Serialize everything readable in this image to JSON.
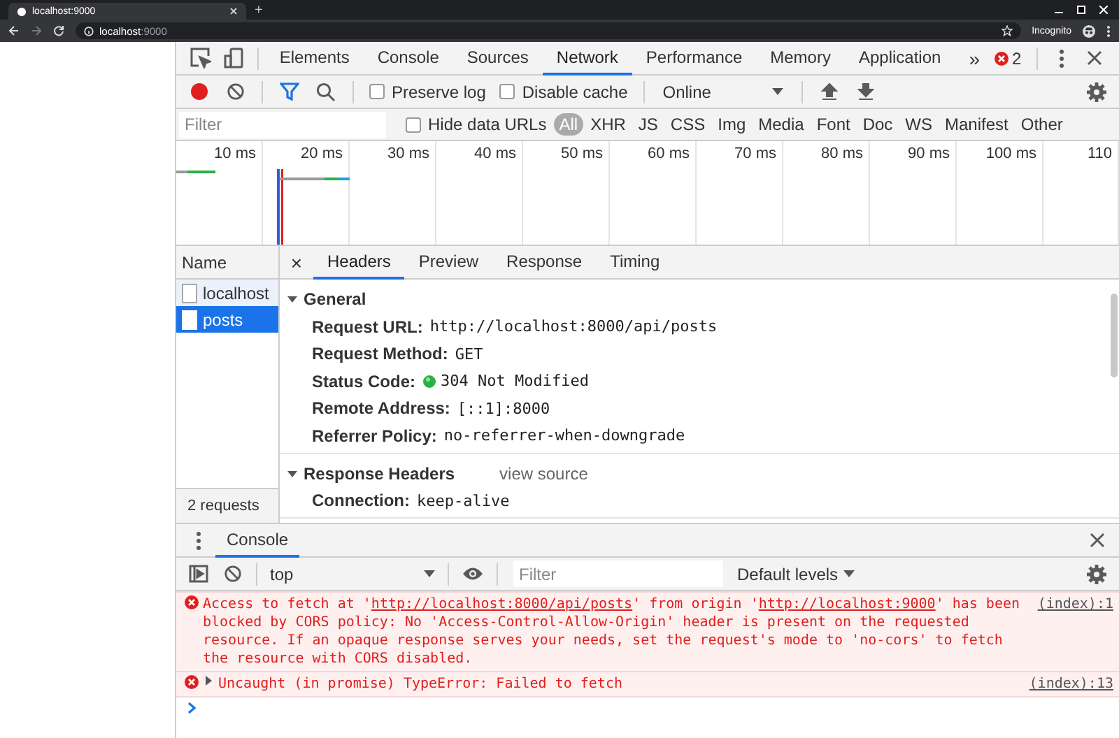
{
  "browser": {
    "tab_title": "localhost:9000",
    "new_tab": "+",
    "address_host": "localhost",
    "address_port": ":9000",
    "profile": "Incognito"
  },
  "devtools_tabs": {
    "tabs": [
      {
        "label": "Elements",
        "selected": false
      },
      {
        "label": "Console",
        "selected": false
      },
      {
        "label": "Sources",
        "selected": false
      },
      {
        "label": "Network",
        "selected": true
      },
      {
        "label": "Performance",
        "selected": false
      },
      {
        "label": "Memory",
        "selected": false
      },
      {
        "label": "Application",
        "selected": false
      }
    ],
    "more": "»",
    "error_count": "2"
  },
  "network_toolbar": {
    "recording": true,
    "preserve_log": {
      "label": "Preserve log",
      "checked": false
    },
    "disable_cache": {
      "label": "Disable cache",
      "checked": false
    },
    "throttling": "Online"
  },
  "filter_bar": {
    "placeholder": "Filter",
    "hide_data_urls": {
      "label": "Hide data URLs",
      "checked": false
    },
    "types": [
      {
        "label": "All",
        "selected": true
      },
      {
        "label": "XHR",
        "selected": false
      },
      {
        "label": "JS",
        "selected": false
      },
      {
        "label": "CSS",
        "selected": false
      },
      {
        "label": "Img",
        "selected": false
      },
      {
        "label": "Media",
        "selected": false
      },
      {
        "label": "Font",
        "selected": false
      },
      {
        "label": "Doc",
        "selected": false
      },
      {
        "label": "WS",
        "selected": false
      },
      {
        "label": "Manifest",
        "selected": false
      },
      {
        "label": "Other",
        "selected": false
      }
    ]
  },
  "overview": {
    "ticks": [
      "10 ms",
      "20 ms",
      "30 ms",
      "40 ms",
      "50 ms",
      "60 ms",
      "70 ms",
      "80 ms",
      "90 ms",
      "100 ms",
      "110"
    ]
  },
  "requests": {
    "header": "Name",
    "items": [
      {
        "name": "localhost",
        "selected": false
      },
      {
        "name": "posts",
        "selected": true
      }
    ],
    "summary": "2 requests"
  },
  "details": {
    "close": "×",
    "tabs": [
      {
        "label": "Headers",
        "selected": true
      },
      {
        "label": "Preview",
        "selected": false
      },
      {
        "label": "Response",
        "selected": false
      },
      {
        "label": "Timing",
        "selected": false
      }
    ],
    "sections": [
      {
        "title": "General",
        "expanded": true,
        "rows": [
          {
            "key": "Request URL:",
            "value": "http://localhost:8000/api/posts",
            "kind": "plain"
          },
          {
            "key": "Request Method:",
            "value": "GET",
            "kind": "plain"
          },
          {
            "key": "Status Code:",
            "value": "304 Not Modified",
            "kind": "status"
          },
          {
            "key": "Remote Address:",
            "value": "[::1]:8000",
            "kind": "plain"
          },
          {
            "key": "Referrer Policy:",
            "value": "no-referrer-when-downgrade",
            "kind": "plain"
          }
        ]
      },
      {
        "title": "Response Headers",
        "link": "view source",
        "expanded": true,
        "rows": [
          {
            "key": "Connection:",
            "value": "keep-alive",
            "kind": "plain"
          }
        ]
      }
    ]
  },
  "console": {
    "tab": "Console",
    "context": "top",
    "filter_placeholder": "Filter",
    "levels": "Default levels",
    "messages": [
      {
        "kind": "error",
        "expandable": false,
        "source": "(index):1",
        "parts": [
          {
            "text": "Access to fetch at '",
            "kind": "text"
          },
          {
            "text": "http://localhost:8000/api/posts",
            "kind": "link"
          },
          {
            "text": "' from origin '",
            "kind": "text"
          },
          {
            "text": "http://localhost:9000",
            "kind": "link"
          },
          {
            "text": "' has been blocked by CORS policy: No 'Access-Control-Allow-Origin' header is present on the requested resource. If an opaque response serves your needs, set the request's mode to 'no-cors' to fetch the resource with CORS disabled.",
            "kind": "text"
          }
        ]
      },
      {
        "kind": "error",
        "expandable": true,
        "source": "(index):13",
        "parts": [
          {
            "text": "Uncaught (in promise) TypeError: Failed to fetch",
            "kind": "text"
          }
        ]
      }
    ]
  }
}
